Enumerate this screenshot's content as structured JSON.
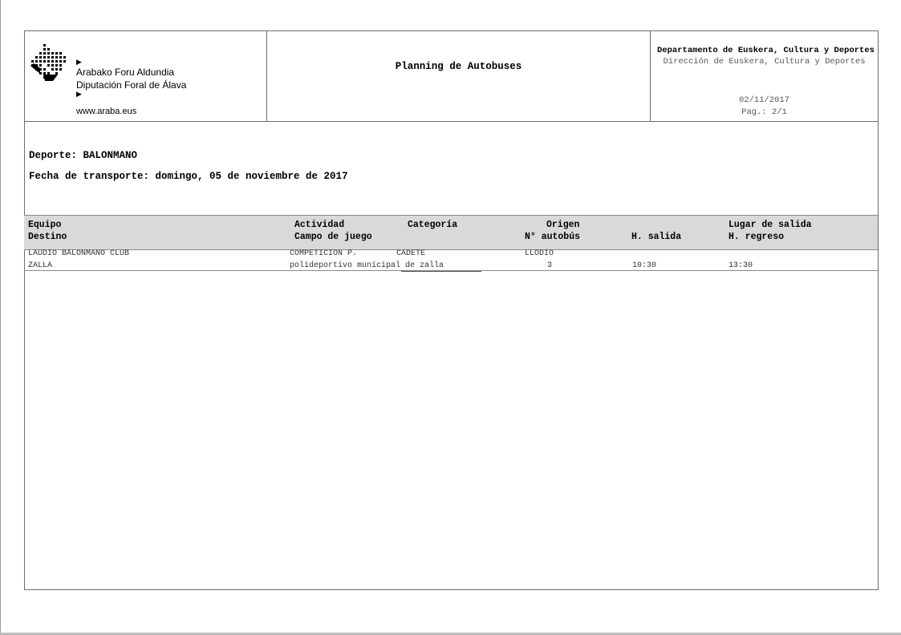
{
  "header": {
    "logo": {
      "line1": "Arabako Foru Aldundia",
      "line2": "Diputación Foral de Álava",
      "website": "www.araba.eus",
      "arrow": "▶"
    },
    "title": "Planning de Autobuses",
    "department": "Departamento de Euskera, Cultura y Deportes",
    "department_sub": "Dirección de Euskera, Cultura y Deportes",
    "date": "02/11/2017",
    "page": "Pag.: 2/1"
  },
  "info": {
    "sport": "Deporte: BALONMANO",
    "transport_date": "Fecha de transporte: domingo, 05 de noviembre de 2017"
  },
  "table": {
    "headers": {
      "equipo": "Equipo",
      "actividad": "Actividad",
      "categoria": "Categoría",
      "origen": "Origen",
      "lugar_salida": "Lugar de salida",
      "destino": "Destino",
      "campo": "Campo de juego",
      "num_autobus": "N° autobús",
      "h_salida": "H. salida",
      "h_regreso": "H. regreso"
    },
    "rows": [
      {
        "equipo": "LAUDIO BALONMANO CLUB",
        "actividad": "COMPETICION P.",
        "categoria": "CADETE",
        "origen": "LLODIO",
        "lugar_salida": "",
        "destino": "ZALLA",
        "campo": "polideportivo municipal de zalla",
        "num_autobus": "3",
        "h_salida": "10:30",
        "h_regreso": "13:30"
      }
    ]
  }
}
